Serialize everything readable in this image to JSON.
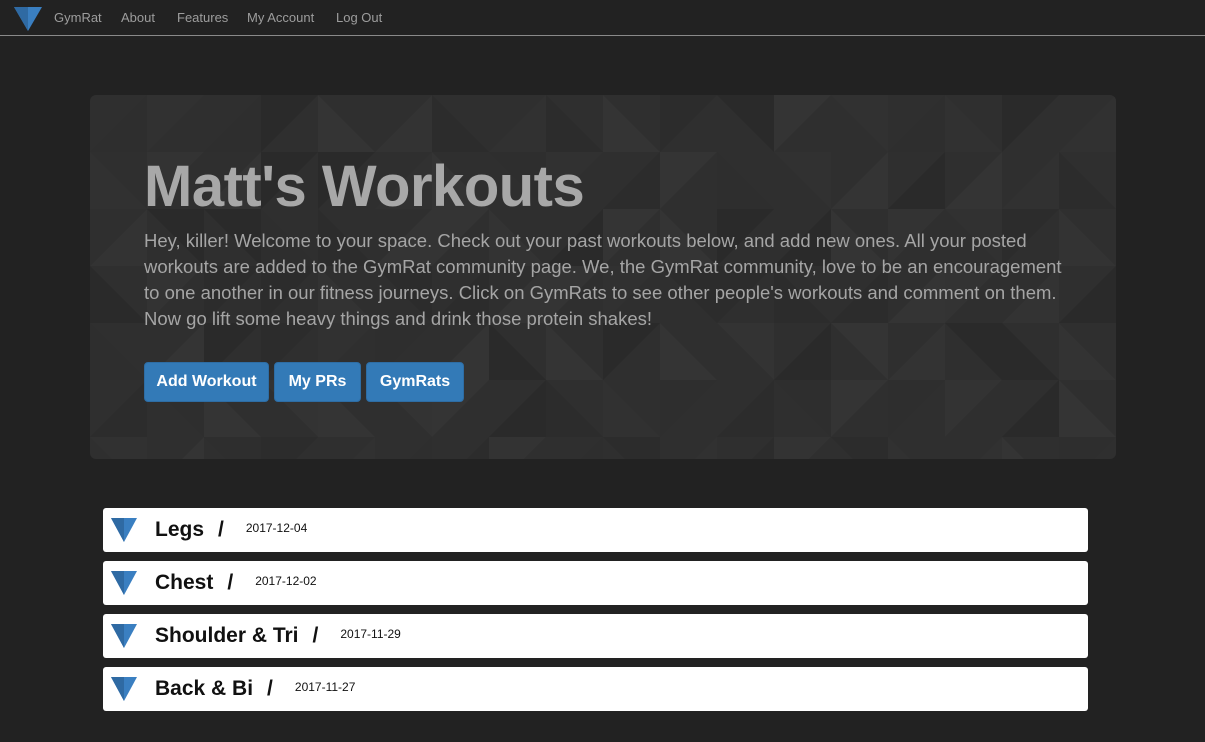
{
  "nav": {
    "brand": "GymRat",
    "links": [
      "About",
      "Features",
      "My Account",
      "Log Out"
    ],
    "logo_icon": "triangle-down-logo",
    "logo_color": "#3a7fc1"
  },
  "hero": {
    "title": "Matt's Workouts",
    "description": "Hey, killer! Welcome to your space. Check out your past workouts below, and add new ones. All your posted workouts are added to the GymRat community page. We, the GymRat community, love to be an encouragement to one another in our fitness journeys. Click on GymRats to see other people's workouts and comment on them. Now go lift some heavy things and drink those protein shakes!",
    "buttons": [
      "Add Workout",
      "My PRs",
      "GymRats"
    ],
    "button_color": "#337ab7"
  },
  "workouts": [
    {
      "name": "Legs",
      "separator": "/",
      "date": "2017-12-04"
    },
    {
      "name": "Chest",
      "separator": "/",
      "date": "2017-12-02"
    },
    {
      "name": "Shoulder & Tri",
      "separator": "/",
      "date": "2017-11-29"
    },
    {
      "name": "Back & Bi",
      "separator": "/",
      "date": "2017-11-27"
    }
  ]
}
